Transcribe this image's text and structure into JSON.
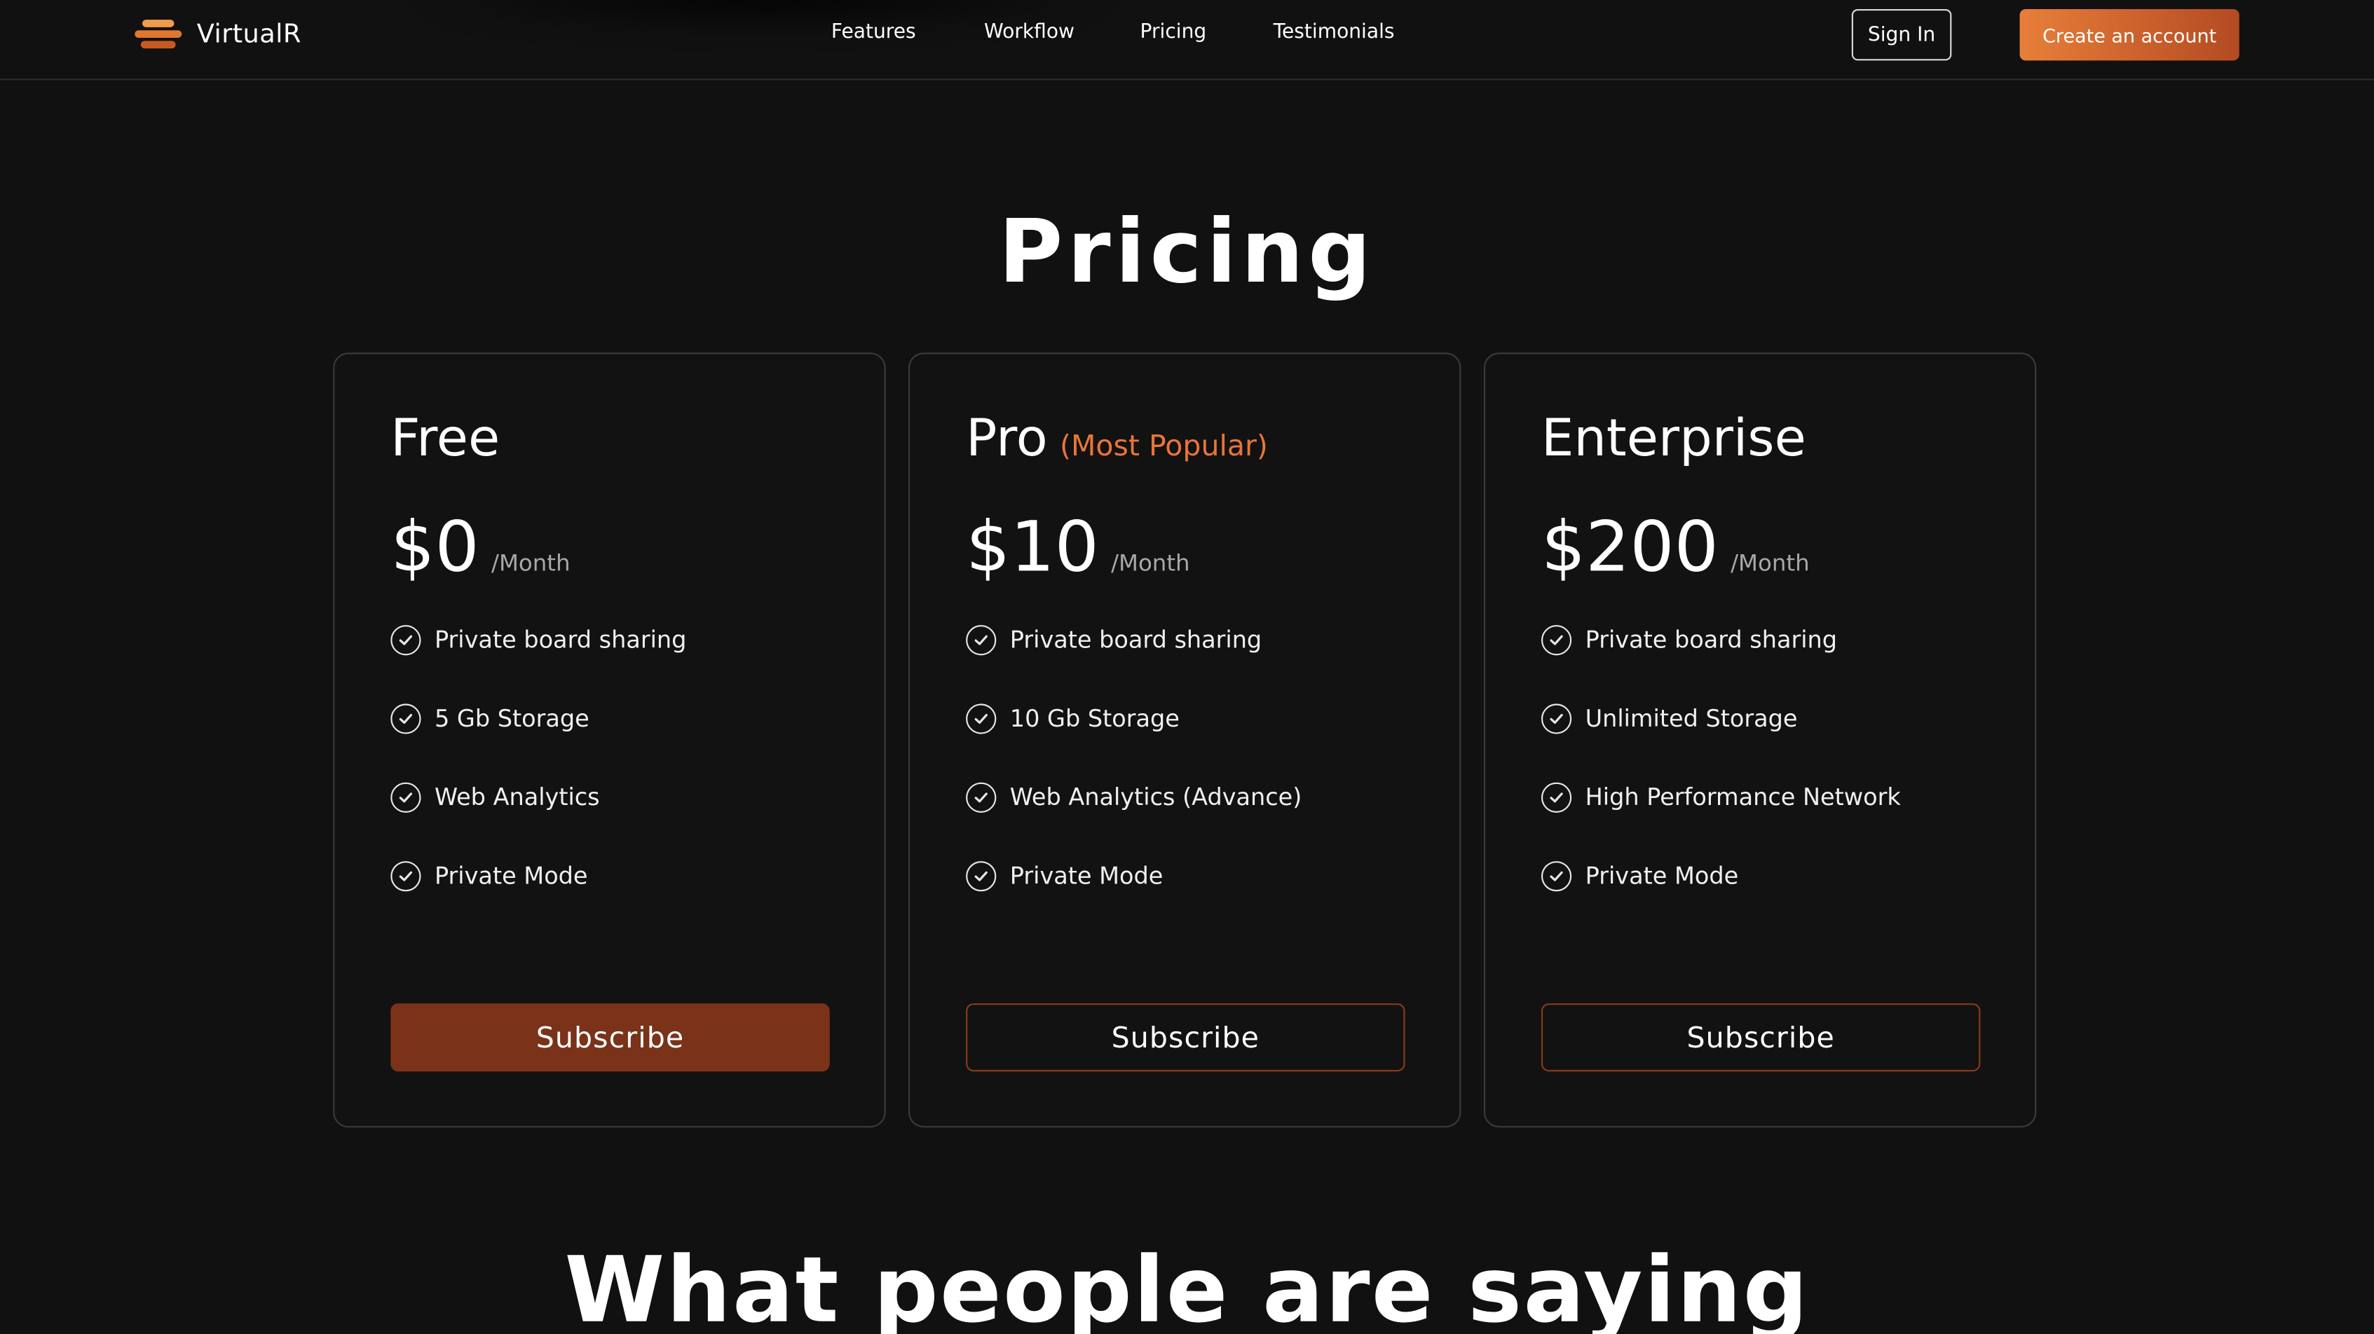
{
  "brand": {
    "name": "VirtualR",
    "logo_icon": "layered-stack-logo-icon"
  },
  "nav": {
    "features": "Features",
    "workflow": "Workflow",
    "pricing": "Pricing",
    "testimonials": "Testimonials"
  },
  "header": {
    "sign_in": "Sign In",
    "create_account": "Create an account"
  },
  "pricing": {
    "title": "Pricing",
    "plans": [
      {
        "name": "Free",
        "badge": "",
        "price": "$0",
        "period": "/Month",
        "features": [
          "Private board sharing",
          "5 Gb Storage",
          "Web Analytics",
          "Private Mode"
        ],
        "cta": "Subscribe"
      },
      {
        "name": "Pro",
        "badge": "(Most Popular)",
        "price": "$10",
        "period": "/Month",
        "features": [
          "Private board sharing",
          "10 Gb Storage",
          "Web Analytics (Advance)",
          "Private Mode"
        ],
        "cta": "Subscribe"
      },
      {
        "name": "Enterprise",
        "badge": "",
        "price": "$200",
        "period": "/Month",
        "features": [
          "Private board sharing",
          "Unlimited Storage",
          "High Performance Network",
          "Private Mode"
        ],
        "cta": "Subscribe"
      }
    ]
  },
  "testimonials": {
    "title": "What people are saying"
  },
  "colors": {
    "accent": "#e8753a",
    "button_fill": "#7a3219",
    "background": "#111111"
  }
}
